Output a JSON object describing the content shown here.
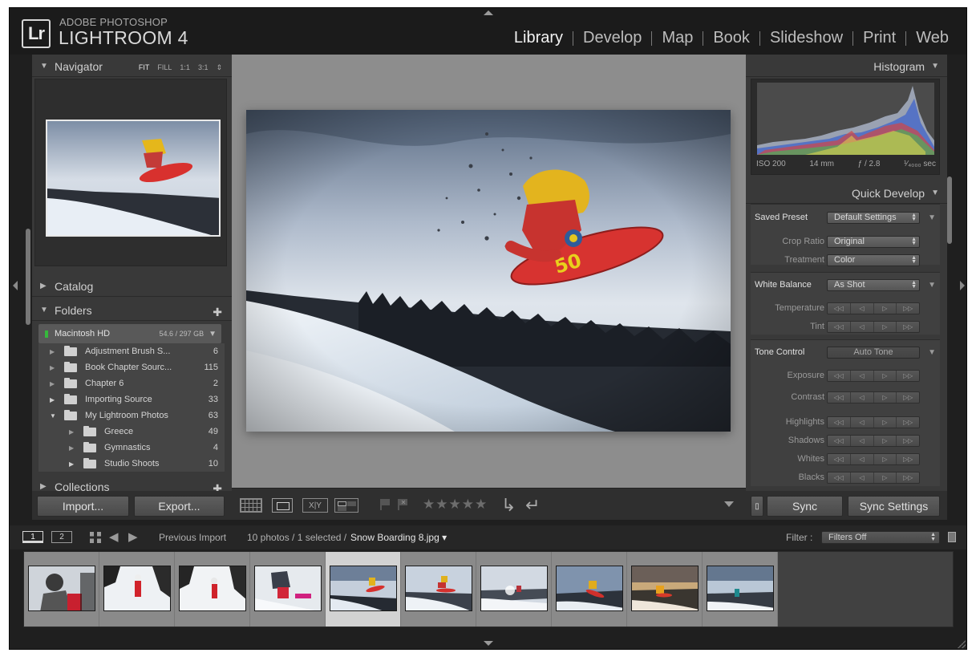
{
  "app": {
    "logo_mark": "Lr",
    "logo_sub": "ADOBE PHOTOSHOP",
    "logo_main": "LIGHTROOM 4"
  },
  "modules": [
    {
      "label": "Library",
      "active": true
    },
    {
      "label": "Develop"
    },
    {
      "label": "Map"
    },
    {
      "label": "Book"
    },
    {
      "label": "Slideshow"
    },
    {
      "label": "Print"
    },
    {
      "label": "Web"
    }
  ],
  "left_panel": {
    "navigator": {
      "title": "Navigator",
      "options": [
        "FIT",
        "FILL",
        "1:1",
        "3:1"
      ],
      "options_arrow": "⇕"
    },
    "catalog": {
      "title": "Catalog"
    },
    "folders": {
      "title": "Folders",
      "volume": {
        "name": "Macintosh HD",
        "size": "54.6 / 297 GB"
      },
      "items": [
        {
          "name": "Adjustment Brush S...",
          "count": "6",
          "level": 0,
          "expanded": false
        },
        {
          "name": "Book Chapter Sourc...",
          "count": "115",
          "level": 0,
          "expanded": false
        },
        {
          "name": "Chapter 6",
          "count": "2",
          "level": 0,
          "expanded": false
        },
        {
          "name": "Importing Source",
          "count": "33",
          "level": 0,
          "expanded": false
        },
        {
          "name": "My Lightroom Photos",
          "count": "63",
          "level": 0,
          "expanded": true
        },
        {
          "name": "Greece",
          "count": "49",
          "level": 1,
          "expanded": false
        },
        {
          "name": "Gymnastics",
          "count": "4",
          "level": 1,
          "expanded": false
        },
        {
          "name": "Studio Shoots",
          "count": "10",
          "level": 1,
          "expanded": false
        }
      ]
    },
    "collections": {
      "title": "Collections"
    },
    "import_label": "Import...",
    "export_label": "Export..."
  },
  "right_panel": {
    "histogram": {
      "title": "Histogram",
      "iso": "ISO 200",
      "focal": "14 mm",
      "aperture": "ƒ / 2.8",
      "shutter": "¹⁄₄₀₀₀ sec"
    },
    "quick_develop": {
      "title": "Quick Develop",
      "saved_preset_label": "Saved Preset",
      "saved_preset_value": "Default Settings",
      "crop_ratio_label": "Crop Ratio",
      "crop_ratio_value": "Original",
      "treatment_label": "Treatment",
      "treatment_value": "Color",
      "white_balance_label": "White Balance",
      "white_balance_value": "As Shot",
      "temperature_label": "Temperature",
      "tint_label": "Tint",
      "tone_control_label": "Tone Control",
      "auto_tone_label": "Auto Tone",
      "exposure_label": "Exposure",
      "contrast_label": "Contrast",
      "highlights_label": "Highlights",
      "shadows_label": "Shadows",
      "whites_label": "Whites",
      "blacks_label": "Blacks"
    },
    "sync_label": "Sync",
    "sync_settings_label": "Sync Settings"
  },
  "toolbar": {
    "stars": "★★★★★",
    "compare_label": "X|Y"
  },
  "filmstrip_bar": {
    "monitor1": "1",
    "monitor2": "2",
    "source": "Previous Import",
    "count_text": "10 photos / 1 selected /",
    "filename": "Snow Boarding 8.jpg",
    "filter_label": "Filter :",
    "filter_value": "Filters Off"
  },
  "filmstrip": {
    "selected_index": 4,
    "thumb_count": 10
  }
}
